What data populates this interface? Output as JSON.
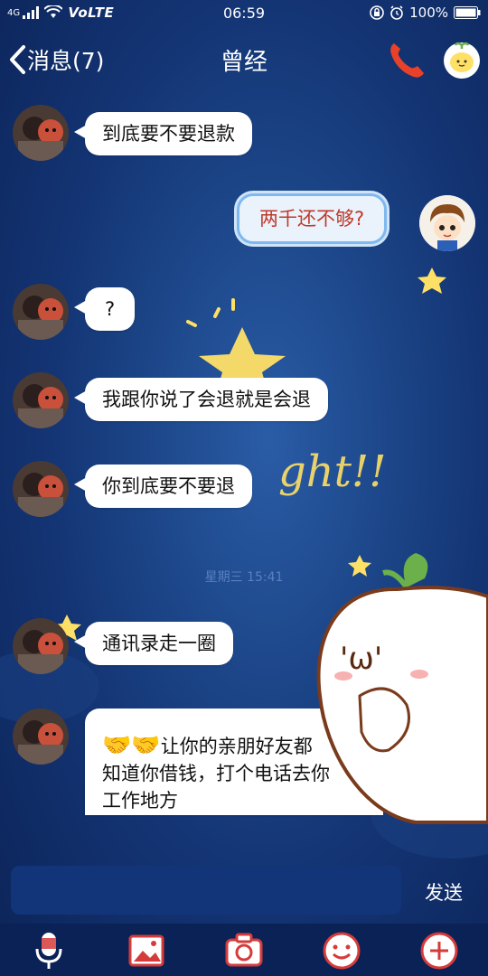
{
  "status_bar": {
    "signal_label": "4G",
    "network": "VoLTE",
    "time": "06:59",
    "battery": "100%"
  },
  "header": {
    "back_label": "消息(7)",
    "title": "曾经"
  },
  "messages": [
    {
      "dir": "in",
      "text": "到底要不要退款"
    },
    {
      "dir": "out",
      "text": "两千还不够?"
    },
    {
      "dir": "in",
      "text": "?"
    },
    {
      "dir": "in",
      "text": "我跟你说了会退就是会退"
    },
    {
      "dir": "in",
      "text": "你到底要不要退"
    },
    {
      "dir": "in",
      "text": "通讯录走一圈"
    },
    {
      "dir": "in",
      "line1": "让你的亲朋好友都",
      "line2": "知道你借钱，打个电话去你",
      "line3": "工作地方",
      "emoji": "🤝🤝"
    }
  ],
  "timestamp": "星期三 15:41",
  "input": {
    "placeholder": "",
    "send_label": "发送"
  },
  "toolbar": [
    "microphone",
    "image",
    "camera",
    "emoji",
    "more"
  ],
  "colors": {
    "accent": "#7fb8ef",
    "bubble_out_text": "#c0392b",
    "phone": "#e8412a"
  }
}
